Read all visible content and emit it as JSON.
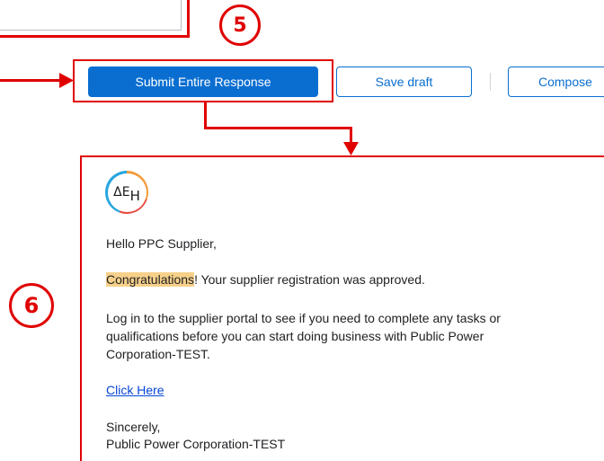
{
  "steps": {
    "step5": "5",
    "step6": "6"
  },
  "toolbar": {
    "submit_label": "Submit Entire Response",
    "save_draft_label": "Save draft",
    "compose_label": "Compose"
  },
  "email": {
    "logo_text": "ΔE",
    "logo_sub": "H",
    "greeting": "Hello PPC Supplier,",
    "highlight": "Congratulations",
    "approved_rest": "! Your supplier registration was approved.",
    "body": "Log in to the supplier portal to see if you need to complete any tasks or qualifications before you can start doing business with Public Power Corporation-TEST.",
    "link_text": "Click Here",
    "closing": "Sincerely,",
    "signature": "Public Power Corporation-TEST"
  },
  "colors": {
    "accent": "#0a6ed1",
    "callout": "#e00000",
    "highlight": "#f7d08a",
    "link": "#0645d6"
  }
}
